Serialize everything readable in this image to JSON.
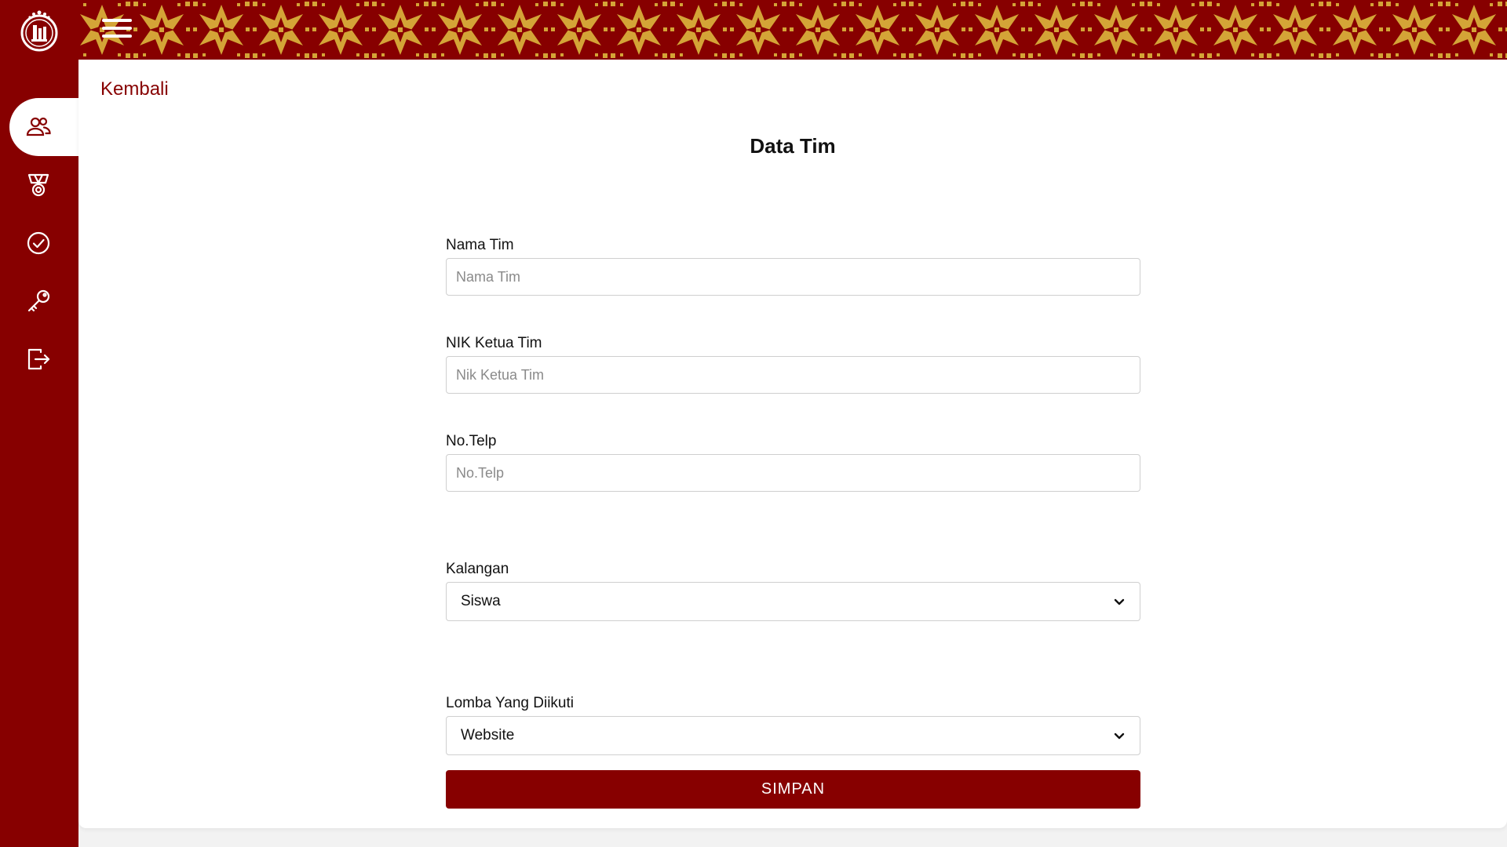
{
  "colors": {
    "primary": "#870000",
    "pattern_gold": "#d4a437",
    "background": "#f2f2f2"
  },
  "sidebar": {
    "logo": "school-crest-logo",
    "items": [
      {
        "icon": "users-icon",
        "active": true
      },
      {
        "icon": "medal-icon",
        "active": false
      },
      {
        "icon": "check-circle-icon",
        "active": false
      },
      {
        "icon": "key-icon",
        "active": false
      },
      {
        "icon": "logout-icon",
        "active": false
      }
    ]
  },
  "header": {
    "menu_icon": "hamburger-icon",
    "pattern": "songket-star-pattern"
  },
  "main": {
    "back_label": "Kembali",
    "title": "Data Tim",
    "form": {
      "team_name": {
        "label": "Nama Tim",
        "placeholder": "Nama Tim",
        "value": ""
      },
      "leader_nik": {
        "label": "NIK Ketua Tim",
        "placeholder": "Nik Ketua Tim",
        "value": ""
      },
      "phone": {
        "label": "No.Telp",
        "placeholder": "No.Telp",
        "value": ""
      },
      "category": {
        "label": "Kalangan",
        "selected": "Siswa"
      },
      "competition": {
        "label": "Lomba Yang Diikuti",
        "selected": "Website"
      },
      "submit_label": "SIMPAN"
    }
  }
}
